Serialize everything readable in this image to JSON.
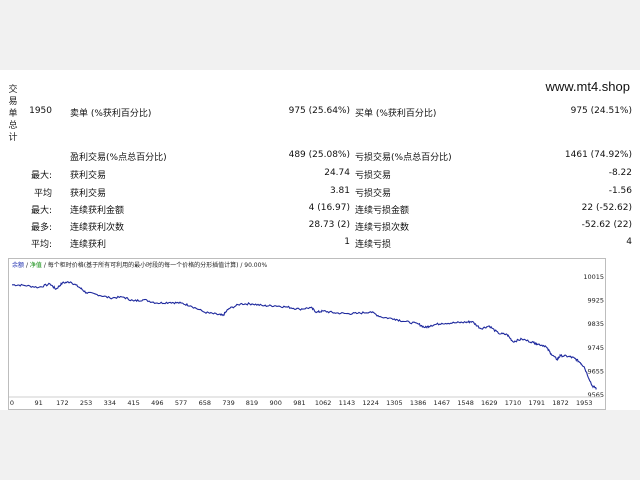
{
  "side_label": "交易单总计",
  "brand": "www.mt4.shop",
  "stats": [
    {
      "l0": "1950",
      "l1": "卖单 (%获利百分比)",
      "v1": "975 (25.64%)",
      "l2": "买单 (%获利百分比)",
      "v2": "975 (24.51%)"
    },
    {
      "l0": "",
      "l1": "",
      "v1": "",
      "l2": "",
      "v2": ""
    },
    {
      "l0": "",
      "l1": "盈利交易(%点总百分比)",
      "v1": "489 (25.08%)",
      "l2": "亏损交易(%点总百分比)",
      "v2": "1461 (74.92%)"
    },
    {
      "l0": "最大:",
      "l1": "获利交易",
      "v1": "24.74",
      "l2": "亏损交易",
      "v2": "-8.22"
    },
    {
      "l0": "平均",
      "l1": "获利交易",
      "v1": "3.81",
      "l2": "亏损交易",
      "v2": "-1.56"
    },
    {
      "l0": "最大:",
      "l1": "连续获利金额",
      "v1": "4 (16.97)",
      "l2": "连续亏损金额",
      "v2": "22 (-52.62)"
    },
    {
      "l0": "最多:",
      "l1": "连续获利次数",
      "v1": "28.73 (2)",
      "l2": "连续亏损次数",
      "v2": "-52.62 (22)"
    },
    {
      "l0": "平均:",
      "l1": "连续获利",
      "v1": "1",
      "l2": "连续亏损",
      "v2": "4"
    }
  ],
  "chart_legend": {
    "balance": "余额",
    "equity": "净值",
    "text": "每个柜时价格(基于所有可利用的最小时段的每一个价格的分形插值计算) / 90.00%"
  },
  "chart_data": {
    "type": "line",
    "x_ticks": [
      "0",
      "91",
      "172",
      "253",
      "334",
      "415",
      "496",
      "577",
      "658",
      "739",
      "819",
      "900",
      "981",
      "1062",
      "1143",
      "1224",
      "1305",
      "1386",
      "1467",
      "1548",
      "1629",
      "1710",
      "1791",
      "1872",
      "1953"
    ],
    "y_ticks": [
      "10015",
      "9925",
      "9835",
      "9745",
      "9655",
      "9565"
    ],
    "ylim": [
      9565,
      10045
    ],
    "xlim": [
      0,
      2000
    ],
    "line_color": "#1f2a9e",
    "series": [
      {
        "x": 0,
        "y": 9985
      },
      {
        "x": 40,
        "y": 9983
      },
      {
        "x": 91,
        "y": 9975
      },
      {
        "x": 130,
        "y": 9988
      },
      {
        "x": 150,
        "y": 9968
      },
      {
        "x": 172,
        "y": 9992
      },
      {
        "x": 200,
        "y": 9996
      },
      {
        "x": 230,
        "y": 9975
      },
      {
        "x": 253,
        "y": 9955
      },
      {
        "x": 290,
        "y": 9948
      },
      {
        "x": 334,
        "y": 9935
      },
      {
        "x": 380,
        "y": 9938
      },
      {
        "x": 415,
        "y": 9923
      },
      {
        "x": 450,
        "y": 9928
      },
      {
        "x": 496,
        "y": 9915
      },
      {
        "x": 540,
        "y": 9918
      },
      {
        "x": 577,
        "y": 9915
      },
      {
        "x": 610,
        "y": 9905
      },
      {
        "x": 658,
        "y": 9880
      },
      {
        "x": 700,
        "y": 9872
      },
      {
        "x": 720,
        "y": 9868
      },
      {
        "x": 739,
        "y": 9893
      },
      {
        "x": 780,
        "y": 9912
      },
      {
        "x": 819,
        "y": 9912
      },
      {
        "x": 860,
        "y": 9905
      },
      {
        "x": 900,
        "y": 9905
      },
      {
        "x": 940,
        "y": 9900
      },
      {
        "x": 981,
        "y": 9892
      },
      {
        "x": 1020,
        "y": 9898
      },
      {
        "x": 1040,
        "y": 9880
      },
      {
        "x": 1062,
        "y": 9885
      },
      {
        "x": 1100,
        "y": 9878
      },
      {
        "x": 1143,
        "y": 9875
      },
      {
        "x": 1180,
        "y": 9876
      },
      {
        "x": 1224,
        "y": 9882
      },
      {
        "x": 1260,
        "y": 9862
      },
      {
        "x": 1305,
        "y": 9855
      },
      {
        "x": 1340,
        "y": 9845
      },
      {
        "x": 1386,
        "y": 9836
      },
      {
        "x": 1410,
        "y": 9822
      },
      {
        "x": 1430,
        "y": 9830
      },
      {
        "x": 1467,
        "y": 9838
      },
      {
        "x": 1510,
        "y": 9840
      },
      {
        "x": 1548,
        "y": 9842
      },
      {
        "x": 1570,
        "y": 9845
      },
      {
        "x": 1600,
        "y": 9818
      },
      {
        "x": 1629,
        "y": 9828
      },
      {
        "x": 1660,
        "y": 9800
      },
      {
        "x": 1690,
        "y": 9795
      },
      {
        "x": 1710,
        "y": 9768
      },
      {
        "x": 1740,
        "y": 9778
      },
      {
        "x": 1780,
        "y": 9765
      },
      {
        "x": 1791,
        "y": 9760
      },
      {
        "x": 1820,
        "y": 9752
      },
      {
        "x": 1840,
        "y": 9722
      },
      {
        "x": 1860,
        "y": 9700
      },
      {
        "x": 1872,
        "y": 9715
      },
      {
        "x": 1900,
        "y": 9712
      },
      {
        "x": 1920,
        "y": 9705
      },
      {
        "x": 1940,
        "y": 9688
      },
      {
        "x": 1953,
        "y": 9672
      },
      {
        "x": 1980,
        "y": 9600
      },
      {
        "x": 1995,
        "y": 9590
      }
    ]
  }
}
